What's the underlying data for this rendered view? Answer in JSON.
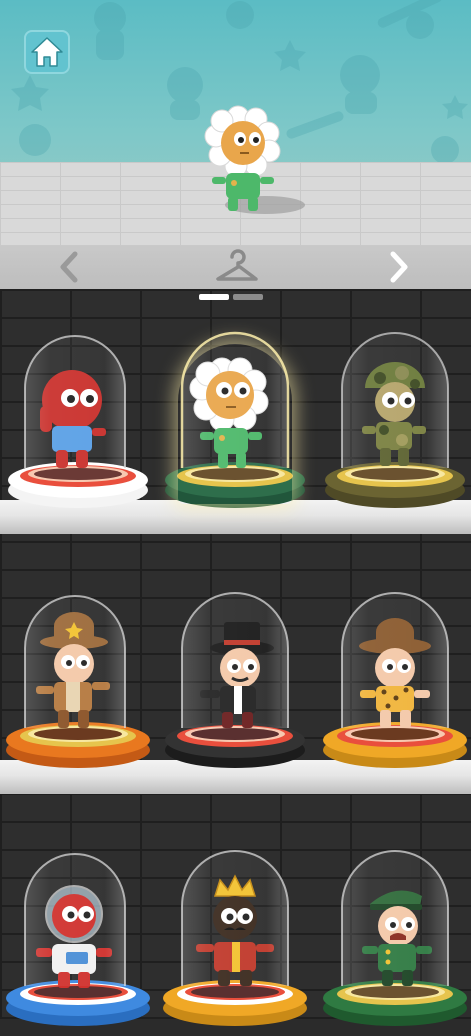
{
  "screen": "character-collection",
  "colors": {
    "sky_top": "#5bbcc4",
    "nav_bg": "#c4c4c4",
    "page_active": "#ffffff",
    "page_inactive": "#8c8c8c"
  },
  "top_bar": {
    "home_icon": "home-icon",
    "prev_icon": "chevron-left-icon",
    "next_icon": "chevron-right-icon",
    "wardrobe_icon": "hanger-icon"
  },
  "preview": {
    "character": "flower"
  },
  "pager": {
    "pages": 2,
    "current": 1
  },
  "shelves": [
    {
      "row": 1,
      "slots": [
        {
          "character": "red-blob",
          "base": "white-red",
          "selected": false
        },
        {
          "character": "flower",
          "base": "green",
          "selected": true
        },
        {
          "character": "camo-soldier",
          "base": "olive",
          "selected": false
        }
      ]
    },
    {
      "row": 2,
      "slots": [
        {
          "character": "sheriff",
          "base": "orange",
          "selected": false
        },
        {
          "character": "gentleman",
          "base": "black",
          "selected": false
        },
        {
          "character": "safari-explorer",
          "base": "orange",
          "selected": false
        }
      ]
    },
    {
      "row": 3,
      "slots": [
        {
          "character": "astronaut",
          "base": "white-blue",
          "selected": false
        },
        {
          "character": "king",
          "base": "orange",
          "selected": false
        },
        {
          "character": "general",
          "base": "green",
          "selected": false
        }
      ]
    }
  ]
}
